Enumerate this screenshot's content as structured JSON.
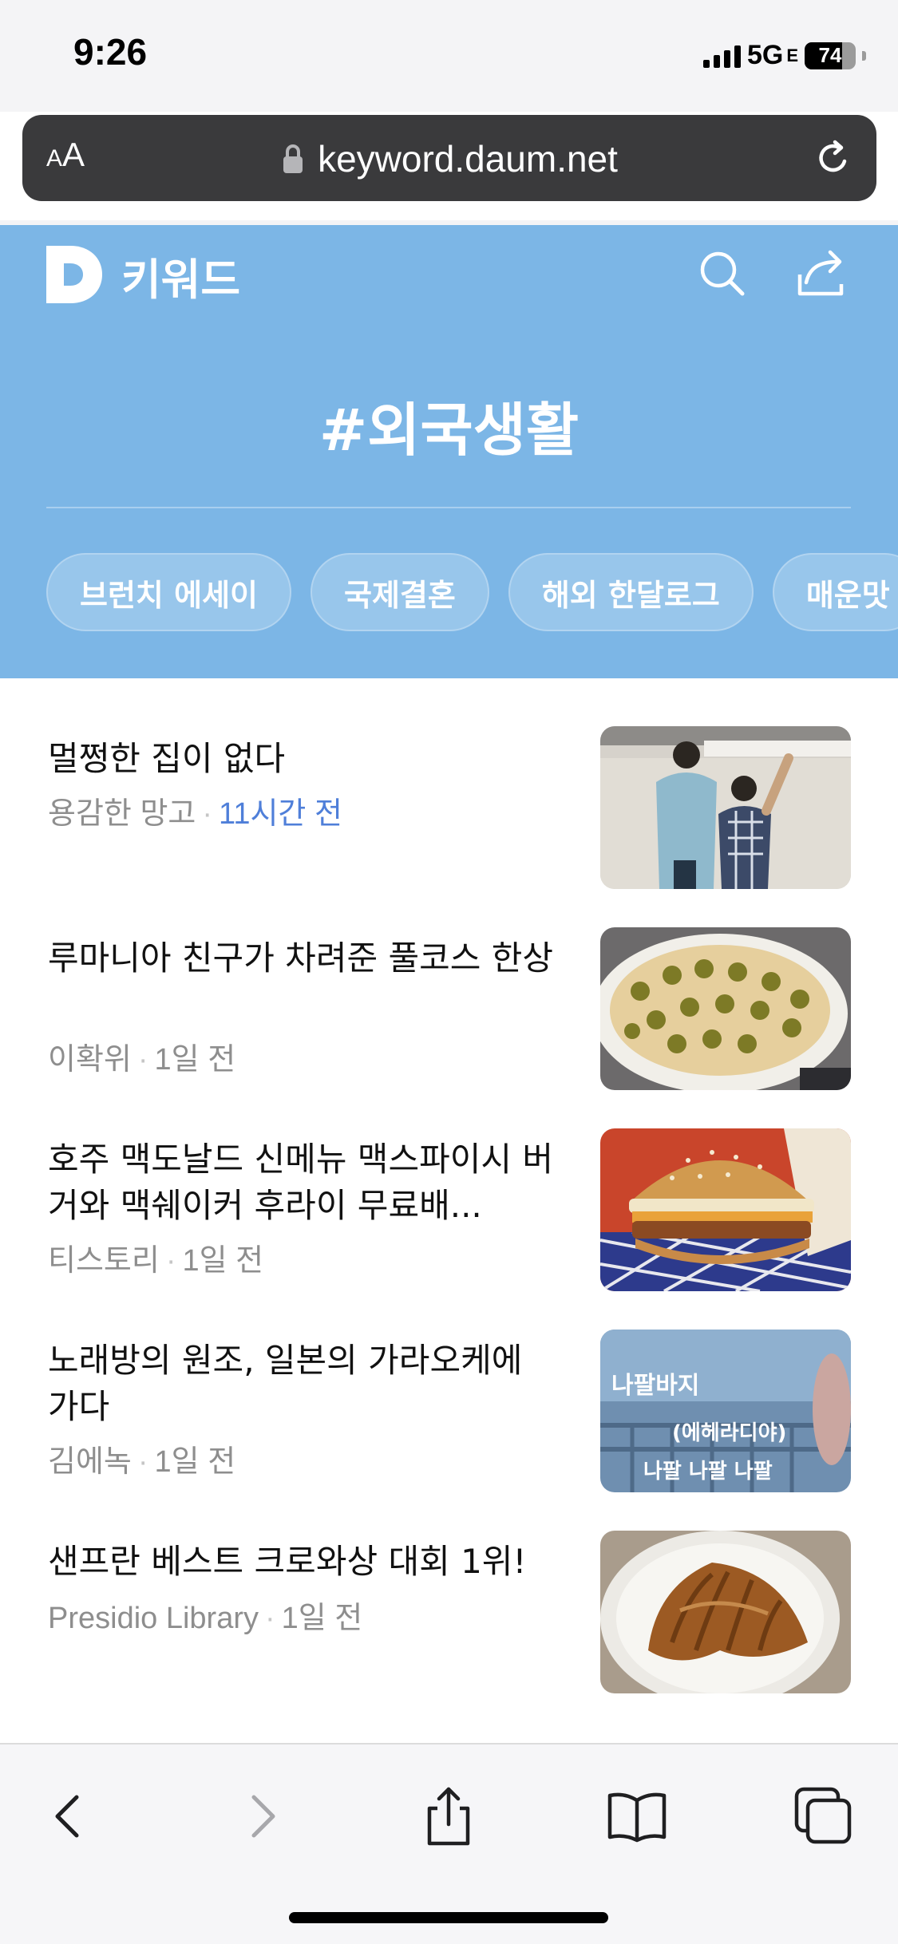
{
  "status_bar": {
    "time": "9:26",
    "network": "5G",
    "network_suffix": "E",
    "battery_level": 74,
    "battery_text": "74"
  },
  "browser": {
    "text_size_label_small": "A",
    "text_size_label_large": "A",
    "url": "keyword.daum.net",
    "lock_icon": "lock-icon",
    "reload_icon": "reload-icon"
  },
  "header": {
    "logo_letter": "D",
    "brand": "키워드",
    "keyword": "#외국생활",
    "background_color": "#7cb6e6",
    "chips": [
      "브런치 에세이",
      "국제결혼",
      "해외 한달로그",
      "매운맛"
    ]
  },
  "articles": [
    {
      "title": "멀쩡한 집이 없다",
      "source": "용감한 망고",
      "time": "11시간 전",
      "time_highlight": true
    },
    {
      "title": "루마니아 친구가 차려준 풀코스 한상",
      "source": "이확위",
      "time": "1일 전",
      "time_highlight": false
    },
    {
      "title": "호주 맥도날드 신메뉴 맥스파이시 버거와 맥쉐이커 후라이 무료배...",
      "source": "티스토리",
      "time": "1일 전",
      "time_highlight": false
    },
    {
      "title": "노래방의 원조, 일본의 가라오케에 가다",
      "source": "김에녹",
      "time": "1일 전",
      "time_highlight": false
    },
    {
      "title": "샌프란 베스트 크로와상 대회 1위!",
      "source": "Presidio Library",
      "time": "1일 전",
      "time_highlight": false
    }
  ],
  "thumbnail_text": {
    "line1": "나팔바지",
    "line2": "(에헤라디야)",
    "line3": "나팔 나팔 나팔"
  },
  "toolbar": {
    "icons": [
      "back-icon",
      "forward-icon",
      "share-icon",
      "bookmarks-icon",
      "tabs-icon"
    ]
  }
}
